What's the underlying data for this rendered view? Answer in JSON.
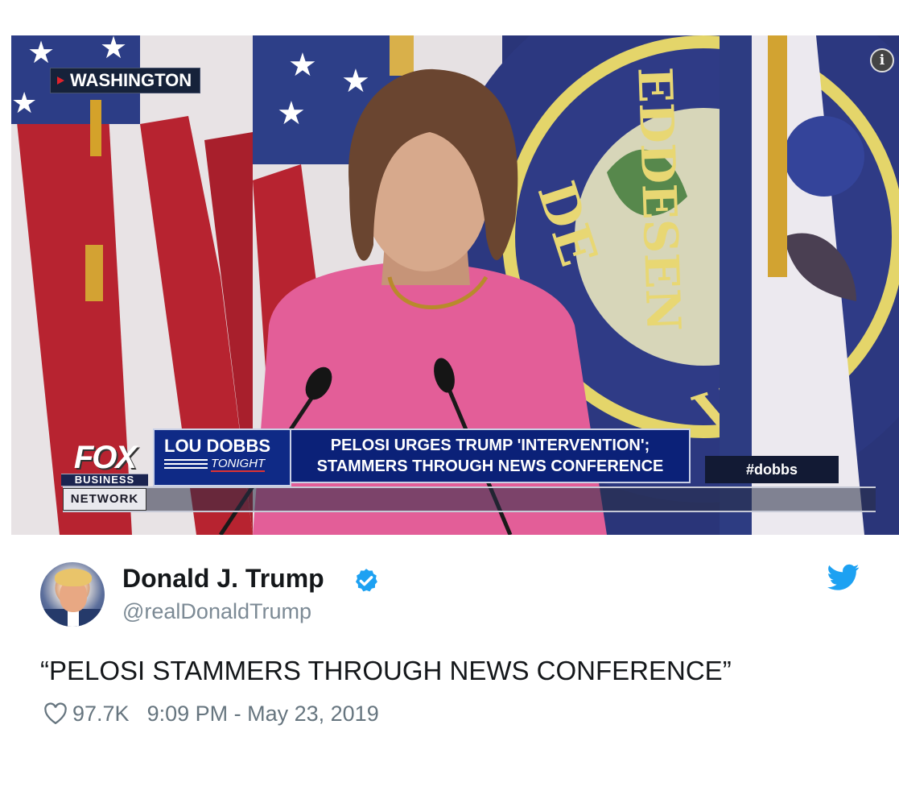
{
  "video": {
    "location": "WASHINGTON",
    "info_icon": "info-icon",
    "lower_third": {
      "channel_logo_main": "FOX",
      "channel_logo_sub": "BUSINESS",
      "network_label": "NETWORK",
      "show_title_top": "LOU DOBBS",
      "show_title_bottom": "TONIGHT",
      "headline_line1": "PELOSI URGES TRUMP 'INTERVENTION';",
      "headline_line2": "STAMMERS THROUGH NEWS CONFERENCE",
      "hashtag": "#dobbs"
    }
  },
  "tweet": {
    "display_name": "Donald J. Trump",
    "verified": true,
    "handle": "@realDonaldTrump",
    "text": "“PELOSI STAMMERS THROUGH NEWS CONFERENCE”",
    "likes": "97.7K",
    "timestamp": "9:09 PM - May 23, 2019",
    "icons": {
      "verified": "verified-badge-icon",
      "platform": "twitter-bird-icon",
      "like": "heart-icon"
    },
    "colors": {
      "accent": "#1da1f2",
      "name": "#14171a",
      "secondary": "#7c8a95"
    }
  }
}
